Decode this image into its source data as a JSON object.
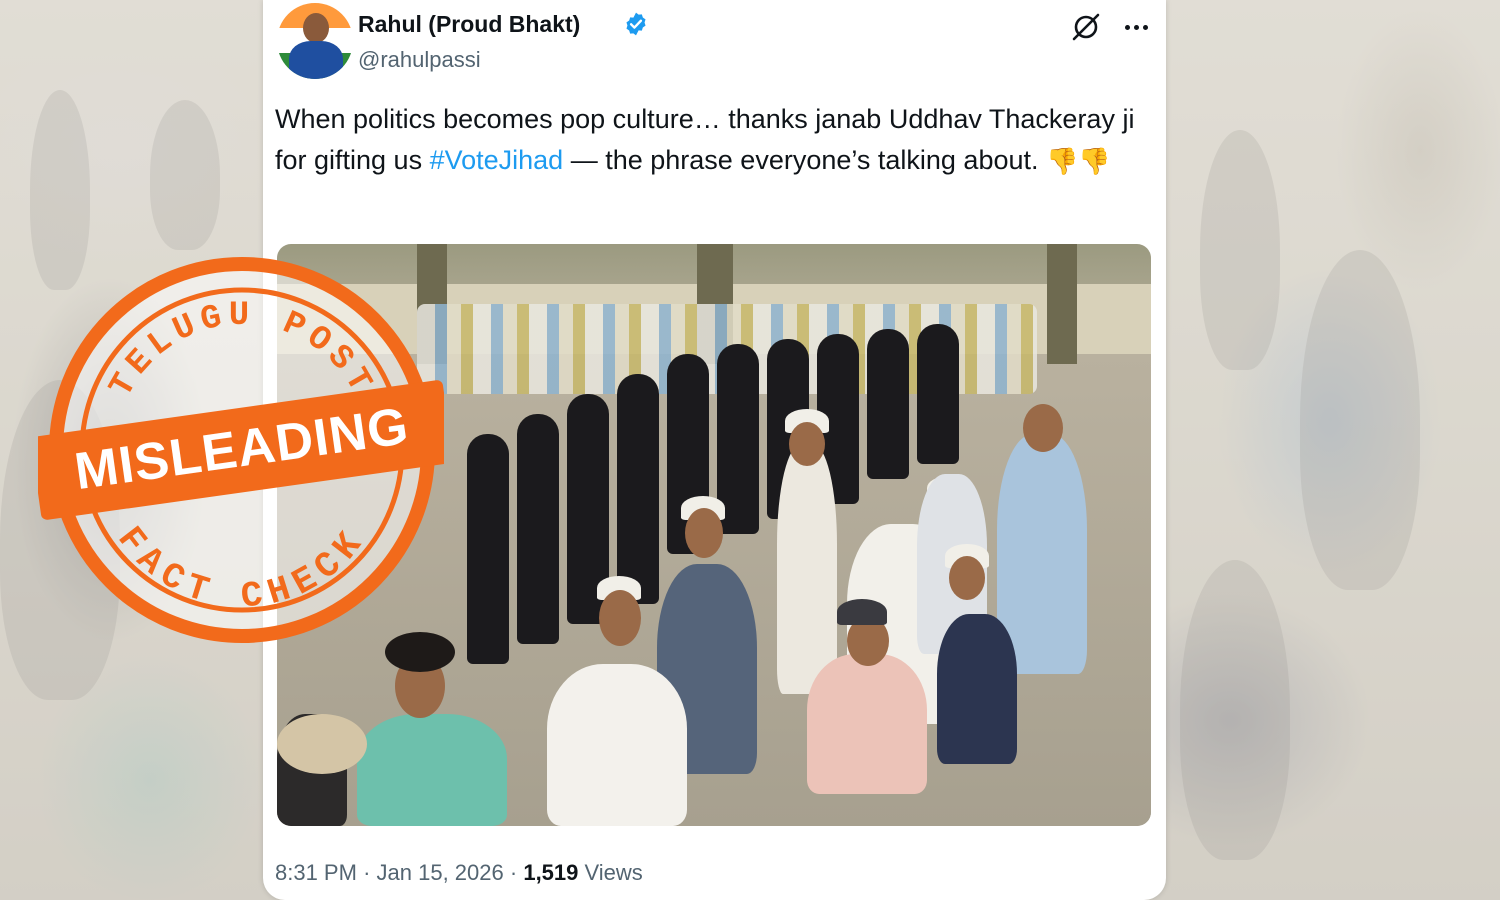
{
  "tweet": {
    "display_name": "Rahul (Proud Bhakt)",
    "handle": "@rahulpassi",
    "text_before": "When politics becomes pop culture… thanks janab Uddhav Thackeray ji for gifting us ",
    "hashtag": "#VoteJihad",
    "text_after": " — the phrase everyone’s talking about. ",
    "emoji": "👎👎",
    "time": "8:31 PM",
    "date": "Jan 15, 2026",
    "views_count": "1,519",
    "views_label": "Views",
    "sep": "·"
  },
  "stamp": {
    "top_text": "TELUGU POST",
    "verdict": "MISLEADING",
    "bottom_text": "FACT CHECK",
    "color": "#f26a1b"
  },
  "colors": {
    "accent": "#1d9bf0",
    "text": "#0f1419",
    "secondary": "#536471"
  },
  "icons": {
    "verified": "verified-badge-icon",
    "grok": "grok-icon",
    "more": "more-options-icon"
  }
}
